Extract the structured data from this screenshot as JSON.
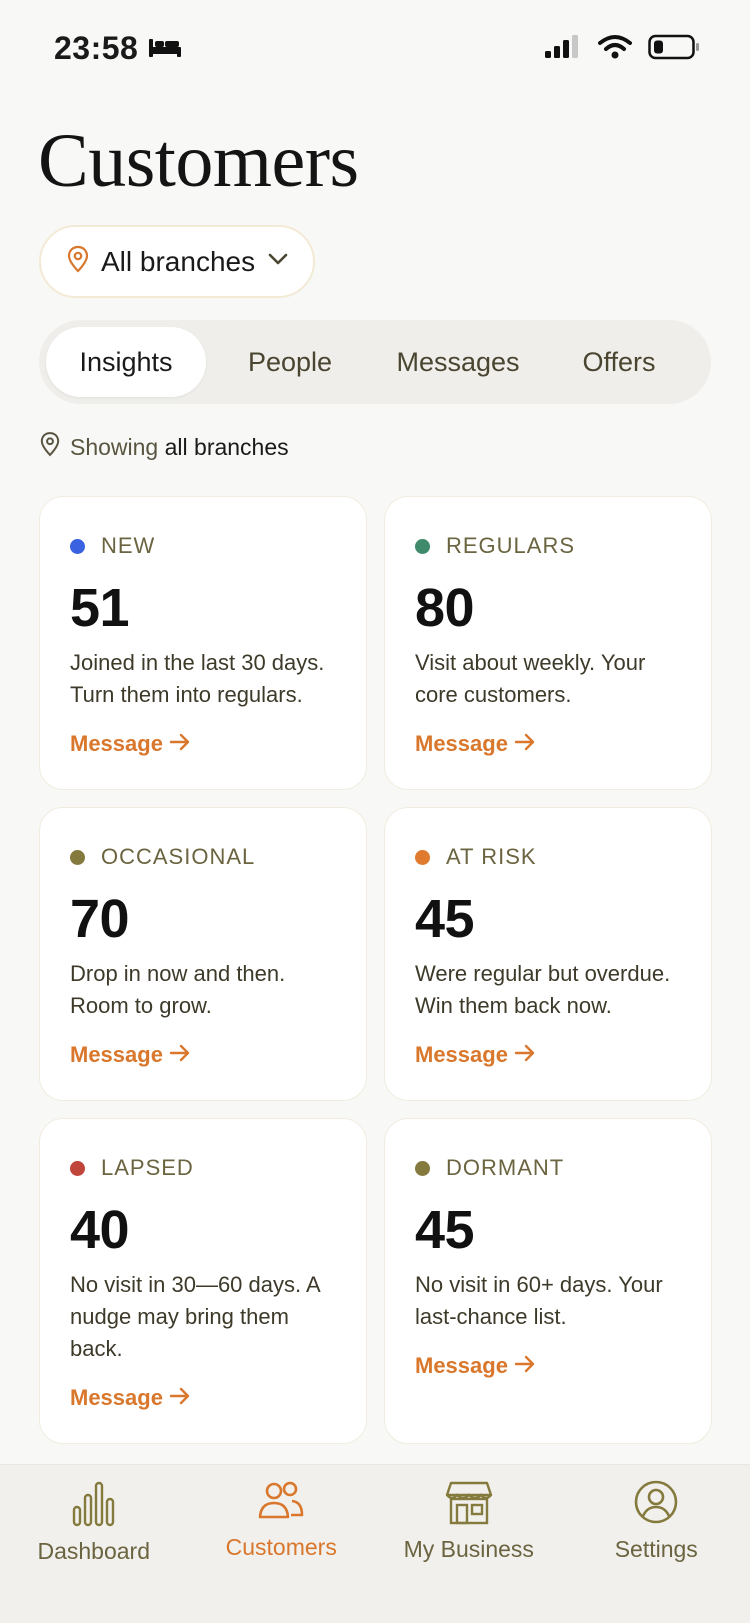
{
  "status_bar": {
    "time": "23:58",
    "icons": [
      "bed-icon",
      "signal-icon",
      "wifi-icon",
      "battery-icon"
    ]
  },
  "page": {
    "title": "Customers"
  },
  "branch_picker": {
    "label": "All branches",
    "icon": "location-pin-icon"
  },
  "tabs": [
    {
      "label": "Insights",
      "active": true
    },
    {
      "label": "People",
      "active": false
    },
    {
      "label": "Messages",
      "active": false
    },
    {
      "label": "Offers",
      "active": false
    }
  ],
  "showing": {
    "prefix": "Showing",
    "value": "all branches"
  },
  "segments": [
    {
      "label": "NEW",
      "value": "51",
      "desc": "Joined in the last 30 days. Turn them into regulars.",
      "action": "Message",
      "color": "#3b62e0"
    },
    {
      "label": "REGULARS",
      "value": "80",
      "desc": "Visit about weekly. Your core customers.",
      "action": "Message",
      "color": "#3f8a6a"
    },
    {
      "label": "OCCASIONAL",
      "value": "70",
      "desc": "Drop in now and then. Room to grow.",
      "action": "Message",
      "color": "#857a3e"
    },
    {
      "label": "AT RISK",
      "value": "45",
      "desc": "Were regular but overdue. Win them back now.",
      "action": "Message",
      "color": "#e07a2e"
    },
    {
      "label": "LAPSED",
      "value": "40",
      "desc": "No visit in 30—60 days. A nudge may bring them back.",
      "action": "Message",
      "color": "#c0453a"
    },
    {
      "label": "DORMANT",
      "value": "45",
      "desc": "No visit in 60+ days. Your last-chance list.",
      "action": "Message",
      "color": "#857a3e"
    }
  ],
  "bottom_nav": [
    {
      "label": "Dashboard",
      "icon": "bar-chart-icon",
      "active": false
    },
    {
      "label": "Customers",
      "icon": "people-icon",
      "active": true
    },
    {
      "label": "My Business",
      "icon": "storefront-icon",
      "active": false
    },
    {
      "label": "Settings",
      "icon": "user-circle-icon",
      "active": false
    }
  ],
  "colors": {
    "accent": "#d9772c",
    "muted_text": "#6b6440"
  }
}
